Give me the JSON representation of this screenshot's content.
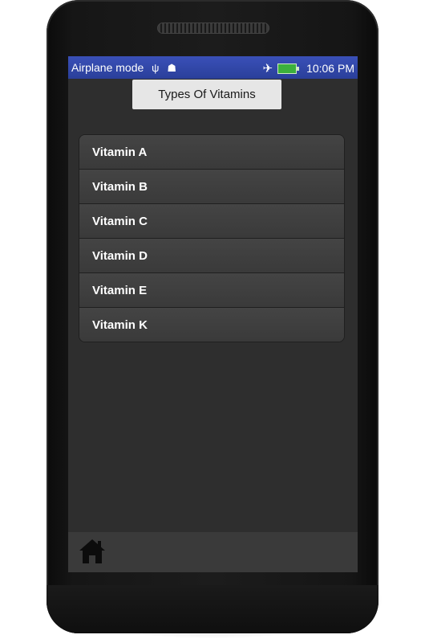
{
  "statusbar": {
    "left_text": "Airplane mode",
    "usb_icon": "usb-icon",
    "android_icon": "android-icon",
    "airplane_icon": "airplane-icon",
    "battery_icon": "battery-charging-icon",
    "time": "10:06 PM"
  },
  "header": {
    "title": "Types Of Vitamins"
  },
  "vitamins": {
    "items": [
      {
        "label": "Vitamin A"
      },
      {
        "label": "Vitamin B"
      },
      {
        "label": "Vitamin C"
      },
      {
        "label": "Vitamin D"
      },
      {
        "label": "Vitamin E"
      },
      {
        "label": "Vitamin K"
      }
    ]
  },
  "bottom_bar": {
    "home_icon": "home-icon"
  },
  "colors": {
    "statusbar": "#2a3f9a",
    "screen_bg": "#2e2e2e",
    "title_bg": "#e6e6e6",
    "list_text": "#ffffff"
  }
}
